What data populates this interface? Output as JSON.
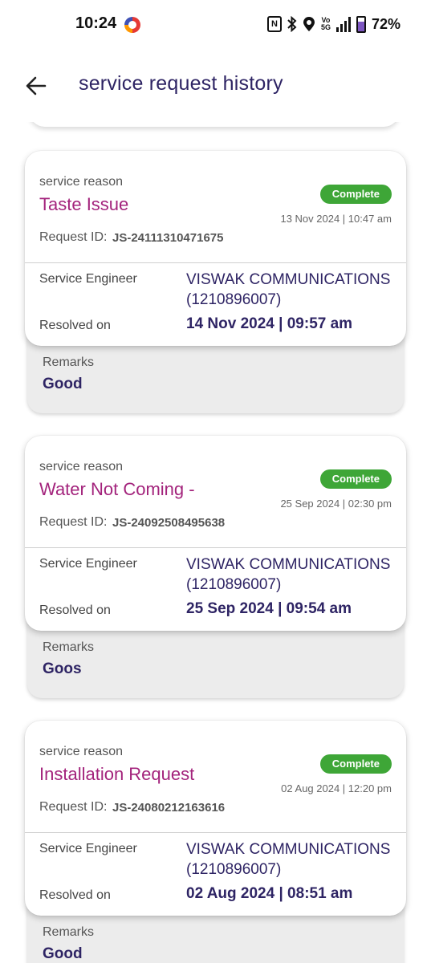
{
  "status_bar": {
    "time": "10:24",
    "network": "5G",
    "volte": "Vo 5G",
    "battery": "72%"
  },
  "header": {
    "title": "service request history"
  },
  "requests": [
    {
      "reason_label": "service reason",
      "reason": "Taste Issue",
      "status": "Complete",
      "datetime": "13 Nov 2024 | 10:47 am",
      "request_id_label": "Request ID:",
      "request_id": "JS-24111310471675",
      "engineer_label": "Service Engineer",
      "engineer": "VISWAK COMMUNICATIONS (1210896007)",
      "resolved_label": "Resolved on",
      "resolved_on": "14 Nov 2024 | 09:57 am",
      "remarks_label": "Remarks",
      "remarks": "Good"
    },
    {
      "reason_label": "service reason",
      "reason": "Water Not Coming -",
      "status": "Complete",
      "datetime": "25 Sep 2024 | 02:30 pm",
      "request_id_label": "Request ID:",
      "request_id": "JS-24092508495638",
      "engineer_label": "Service Engineer",
      "engineer": "VISWAK COMMUNICATIONS (1210896007)",
      "resolved_label": "Resolved on",
      "resolved_on": "25 Sep 2024 | 09:54 am",
      "remarks_label": "Remarks",
      "remarks": "Goos"
    },
    {
      "reason_label": "service reason",
      "reason": "Installation Request",
      "status": "Complete",
      "datetime": "02 Aug 2024 | 12:20 pm",
      "request_id_label": "Request ID:",
      "request_id": "JS-24080212163616",
      "engineer_label": "Service Engineer",
      "engineer": "VISWAK COMMUNICATIONS (1210896007)",
      "resolved_label": "Resolved on",
      "resolved_on": "02 Aug 2024 | 08:51 am",
      "remarks_label": "Remarks",
      "remarks": "Good"
    }
  ],
  "colors": {
    "title": "#2e2464",
    "reason": "#a3237c",
    "badge": "#3ea637",
    "remarks_bg": "#ececec"
  }
}
